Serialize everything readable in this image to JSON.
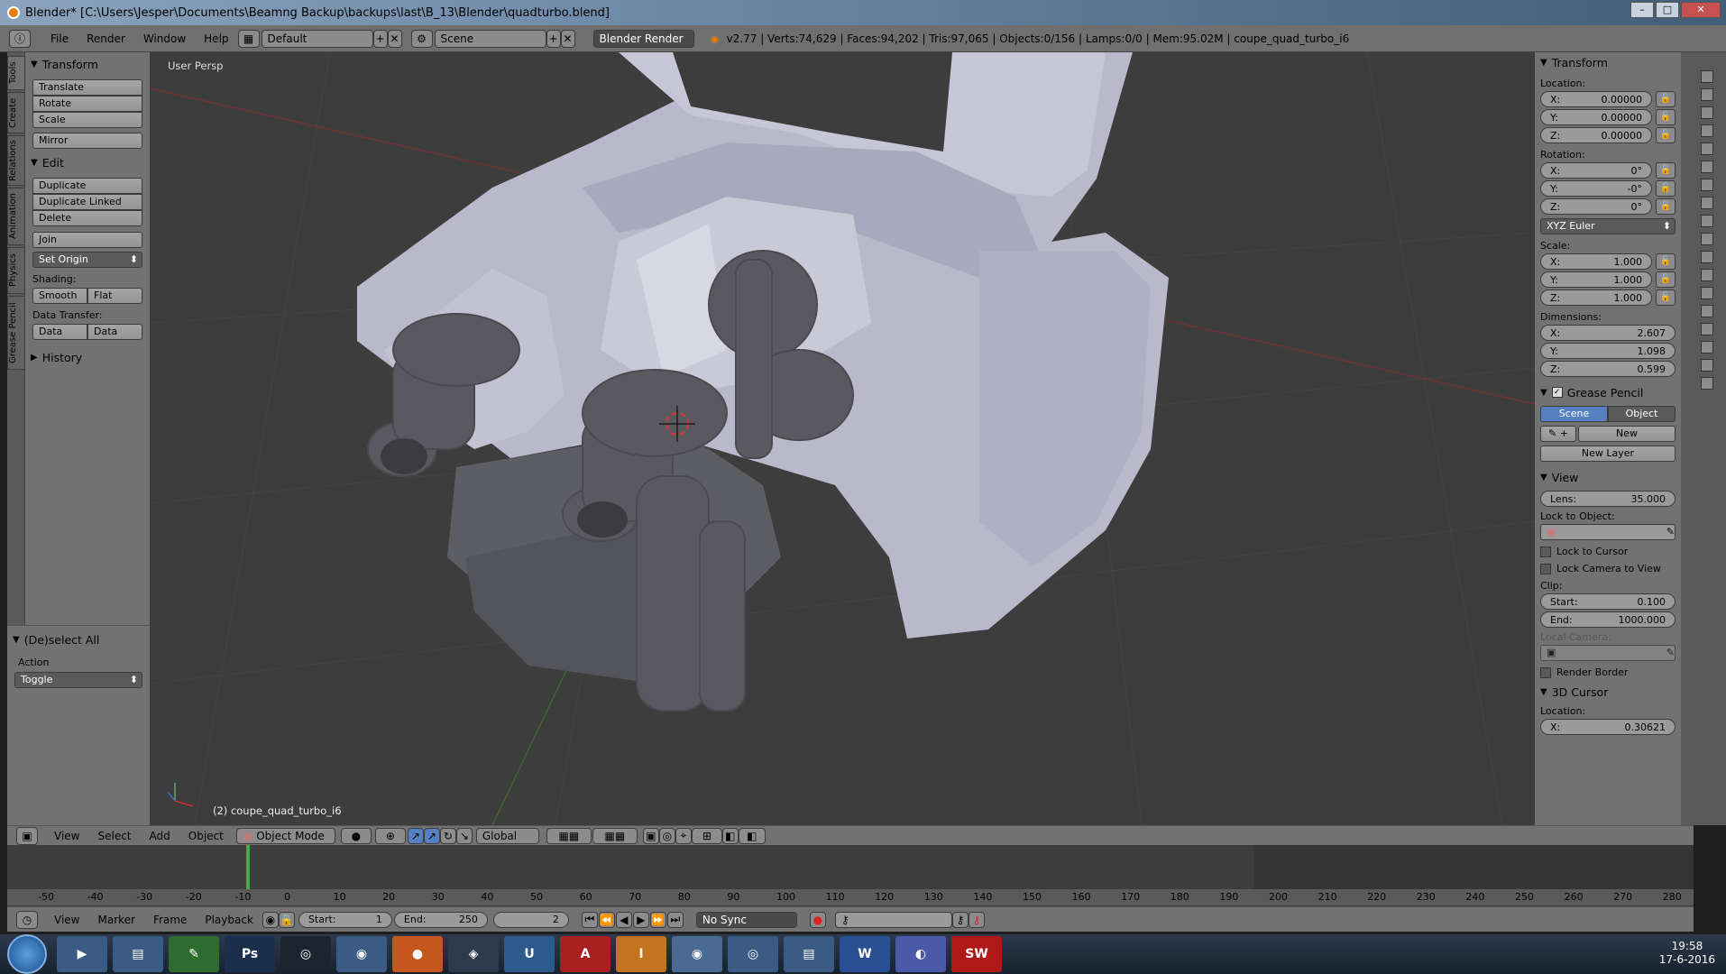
{
  "window": {
    "title": "Blender* [C:\\Users\\Jesper\\Documents\\Beamng Backup\\backups\\last\\B_13\\Blender\\quadturbo.blend]"
  },
  "topbar": {
    "menus": [
      "File",
      "Render",
      "Window",
      "Help"
    ],
    "layout": "Default",
    "scene": "Scene",
    "engine": "Blender Render",
    "stats": "v2.77 | Verts:74,629 | Faces:94,202 | Tris:97,065 | Objects:0/156 | Lamps:0/0 | Mem:95.02M | coupe_quad_turbo_i6"
  },
  "tabs": [
    "Tools",
    "Create",
    "Relations",
    "Animation",
    "Physics",
    "Grease Pencil"
  ],
  "toolshelf": {
    "transform_header": "Transform",
    "transform_buttons": [
      "Translate",
      "Rotate",
      "Scale"
    ],
    "mirror": "Mirror",
    "edit_header": "Edit",
    "edit_buttons": [
      "Duplicate",
      "Duplicate Linked",
      "Delete"
    ],
    "join": "Join",
    "set_origin": "Set Origin",
    "shading_label": "Shading:",
    "smooth": "Smooth",
    "flat": "Flat",
    "data_transfer_label": "Data Transfer:",
    "data": "Data",
    "data_layout": "Data Layo",
    "history": "History"
  },
  "lastop": {
    "header": "(De)select All",
    "action_label": "Action",
    "action_value": "Toggle"
  },
  "viewport": {
    "view_label": "User Persp",
    "object_label": "(2) coupe_quad_turbo_i6"
  },
  "npanel": {
    "transform_header": "Transform",
    "location_label": "Location:",
    "location": [
      {
        "a": "X:",
        "v": "0.00000"
      },
      {
        "a": "Y:",
        "v": "0.00000"
      },
      {
        "a": "Z:",
        "v": "0.00000"
      }
    ],
    "rotation_label": "Rotation:",
    "rotation": [
      {
        "a": "X:",
        "v": "0°"
      },
      {
        "a": "Y:",
        "v": "-0°"
      },
      {
        "a": "Z:",
        "v": "0°"
      }
    ],
    "rotation_mode": "XYZ Euler",
    "scale_label": "Scale:",
    "scale": [
      {
        "a": "X:",
        "v": "1.000"
      },
      {
        "a": "Y:",
        "v": "1.000"
      },
      {
        "a": "Z:",
        "v": "1.000"
      }
    ],
    "dimensions_label": "Dimensions:",
    "dimensions": [
      {
        "a": "X:",
        "v": "2.607"
      },
      {
        "a": "Y:",
        "v": "1.098"
      },
      {
        "a": "Z:",
        "v": "0.599"
      }
    ],
    "grease_header": "Grease Pencil",
    "gp_scene": "Scene",
    "gp_object": "Object",
    "gp_new": "New",
    "gp_new_layer": "New Layer",
    "view_header": "View",
    "lens_label": "Lens:",
    "lens_value": "35.000",
    "lock_object_label": "Lock to Object:",
    "lock_cursor": "Lock to Cursor",
    "lock_camera": "Lock Camera to View",
    "clip_label": "Clip:",
    "clip_start_label": "Start:",
    "clip_start": "0.100",
    "clip_end_label": "End:",
    "clip_end": "1000.000",
    "local_camera_label": "Local Camera:",
    "render_border": "Render Border",
    "cursor_header": "3D Cursor",
    "cursor_location_label": "Location:",
    "cursor_x_label": "X:",
    "cursor_x": "0.30621"
  },
  "viewheader": {
    "menus": [
      "View",
      "Select",
      "Add",
      "Object"
    ],
    "mode": "Object Mode",
    "orientation": "Global"
  },
  "timeline": {
    "ruler": [
      "-50",
      "-40",
      "-30",
      "-20",
      "-10",
      "0",
      "10",
      "20",
      "30",
      "40",
      "50",
      "60",
      "70",
      "80",
      "90",
      "100",
      "110",
      "120",
      "130",
      "140",
      "150",
      "160",
      "170",
      "180",
      "190",
      "200",
      "210",
      "220",
      "230",
      "240",
      "250",
      "260",
      "270",
      "280"
    ],
    "menus": [
      "View",
      "Marker",
      "Frame",
      "Playback"
    ],
    "start_label": "Start:",
    "start": "1",
    "end_label": "End:",
    "end": "250",
    "current": "2",
    "sync": "No Sync"
  },
  "taskbar": {
    "time": "19:58",
    "date": "17-6-2016"
  }
}
